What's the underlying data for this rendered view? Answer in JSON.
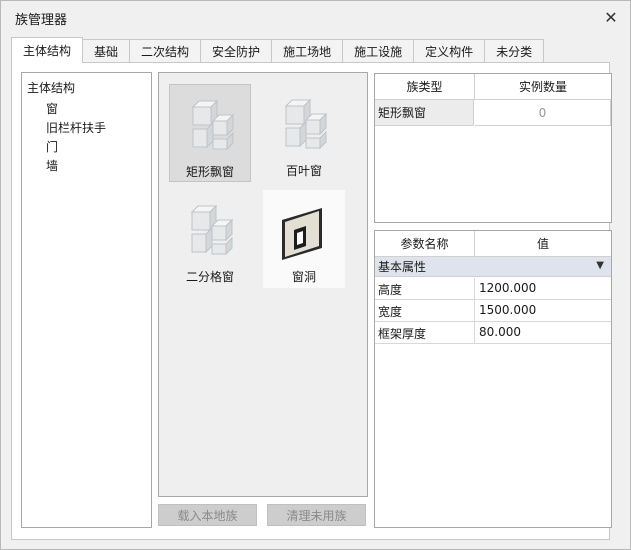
{
  "window": {
    "title": "族管理器"
  },
  "tabs": [
    {
      "label": "主体结构",
      "active": true
    },
    {
      "label": "基础"
    },
    {
      "label": "二次结构"
    },
    {
      "label": "安全防护"
    },
    {
      "label": "施工场地"
    },
    {
      "label": "施工设施"
    },
    {
      "label": "定义构件"
    },
    {
      "label": "未分类"
    }
  ],
  "tree": {
    "root": "主体结构",
    "children": [
      "窗",
      "旧栏杆扶手",
      "门",
      "墙"
    ]
  },
  "gallery": {
    "items": [
      {
        "label": "矩形飘窗",
        "icon": "block-window-icon",
        "selected": true
      },
      {
        "label": "百叶窗",
        "icon": "block-window-icon"
      },
      {
        "label": "二分格窗",
        "icon": "block-window-icon"
      },
      {
        "label": "窗洞",
        "icon": "window-opening-icon"
      }
    ]
  },
  "buttons": {
    "load": "载入本地族",
    "clean": "清理未用族"
  },
  "family_grid": {
    "headers": [
      "族类型",
      "实例数量"
    ],
    "rows": [
      {
        "type": "矩形飘窗",
        "count": "0"
      }
    ]
  },
  "param_grid": {
    "headers": [
      "参数名称",
      "值"
    ],
    "group": "基本属性",
    "rows": [
      {
        "name": "高度",
        "value": "1200.000"
      },
      {
        "name": "宽度",
        "value": "1500.000"
      },
      {
        "name": "框架厚度",
        "value": "80.000"
      }
    ]
  },
  "colors": {
    "selected_tile": "#dcdcdc",
    "group_header": "#dfe3eb",
    "disabled_button": "#cdcdcd"
  }
}
